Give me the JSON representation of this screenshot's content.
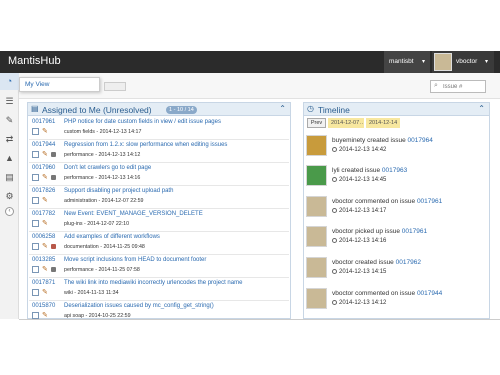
{
  "app": {
    "brand": "MantisHub"
  },
  "topbar": {
    "project": "mantisbt",
    "user": "vboctor"
  },
  "sidebar": {
    "items": [
      {
        "icon": "dashboard-icon",
        "glyph": "◔"
      },
      {
        "icon": "list-icon",
        "glyph": "☰"
      },
      {
        "icon": "edit-icon",
        "glyph": "✎"
      },
      {
        "icon": "sync-icon",
        "glyph": "⇄"
      },
      {
        "icon": "roadmap-icon",
        "glyph": "▲"
      },
      {
        "icon": "chart-icon",
        "glyph": "▤"
      },
      {
        "icon": "settings-icon",
        "glyph": "⚙"
      }
    ],
    "collapse_glyph": "‹"
  },
  "flyout": {
    "label": "My View"
  },
  "search": {
    "placeholder": "Issue #"
  },
  "assigned": {
    "title": "Assigned to Me (Unresolved)",
    "badge": "1 - 10 / 14",
    "issues": [
      {
        "id": "0017961",
        "summary": "PHP notice for date custom fields in view / edit issue pages",
        "meta": "custom fields - 2014-12-13 14:17",
        "dot": ""
      },
      {
        "id": "0017944",
        "summary": "Regression from 1.2.x: slow performance when editing issues",
        "meta": "performance - 2014-12-13 14:12",
        "dot": "#777777"
      },
      {
        "id": "0017960",
        "summary": "Don't let crawlers go to edit page",
        "meta": "performance - 2014-12-13 14:16",
        "dot": "#777777"
      },
      {
        "id": "0017826",
        "summary": "Support disabling per project upload path",
        "meta": "administration - 2014-12-07 22:59",
        "dot": ""
      },
      {
        "id": "0017782",
        "summary": "New Event: EVENT_MANAGE_VERSION_DELETE",
        "meta": "plug-ins - 2014-12-07 22:10",
        "dot": ""
      },
      {
        "id": "0006258",
        "summary": "Add examples of different workflows",
        "meta": "documentation - 2014-11-25 09:48",
        "dot": "#b8584a"
      },
      {
        "id": "0013285",
        "summary": "Move script inclusions from HEAD to document footer",
        "meta": "performance - 2014-11-25 07:58",
        "dot": "#777777"
      },
      {
        "id": "0017871",
        "summary": "The wiki link into mediawiki incorrectly urlencodes the project name",
        "meta": "wiki - 2014-11-13 11:34",
        "dot": ""
      },
      {
        "id": "0015870",
        "summary": "Deserialization issues caused by mc_config_get_string()",
        "meta": "api soap - 2014-10-25 22:59",
        "dot": ""
      }
    ]
  },
  "timeline": {
    "title": "Timeline",
    "prev": "Prev",
    "range_start": "2014-12-07",
    "range_sep": "..",
    "range_end": "2014-12-14",
    "entries": [
      {
        "actor": "buyeminety",
        "action": "created issue",
        "issue": "0017964",
        "ts": "2014-12-13 14:42",
        "avatar": "#c89b3c"
      },
      {
        "actor": "lyli",
        "action": "created issue",
        "issue": "0017963",
        "ts": "2014-12-13 14:45",
        "avatar": "#4a9a4a"
      },
      {
        "actor": "vboctor",
        "action": "commented on issue",
        "issue": "0017961",
        "ts": "2014-12-13 14:17",
        "avatar": "#c9b996"
      },
      {
        "actor": "vboctor",
        "action": "picked up issue",
        "issue": "0017961",
        "ts": "2014-12-13 14:16",
        "avatar": "#c9b996"
      },
      {
        "actor": "vboctor",
        "action": "created issue",
        "issue": "0017962",
        "ts": "2014-12-13 14:15",
        "avatar": "#c9b996"
      },
      {
        "actor": "vboctor",
        "action": "commented on issue",
        "issue": "0017944",
        "ts": "2014-12-13 14:12",
        "avatar": "#c9b996"
      }
    ]
  }
}
